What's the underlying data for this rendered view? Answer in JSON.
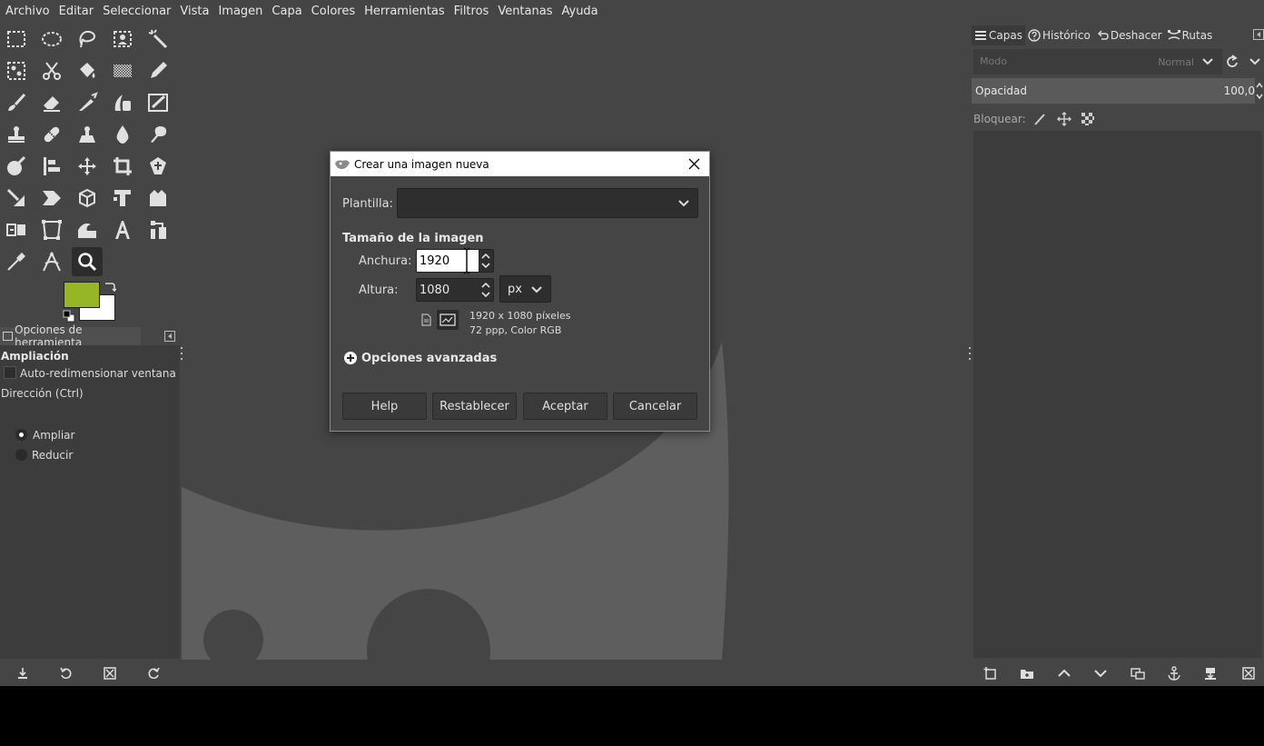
{
  "menubar": {
    "items": [
      "Archivo",
      "Editar",
      "Seleccionar",
      "Vista",
      "Imagen",
      "Capa",
      "Colores",
      "Herramientas",
      "Filtros",
      "Ventanas",
      "Ayuda"
    ]
  },
  "colors": {
    "foreground": "#97b625",
    "background": "#ffffff"
  },
  "tool_options": {
    "tab_label": "Opciones de herramienta",
    "heading": "Ampliación",
    "auto_resize_label": "Auto-redimensionar ventana",
    "direction_label": "Dirección  (Ctrl)",
    "zoom_in_label": "Ampliar",
    "zoom_out_label": "Reducir"
  },
  "right_dock": {
    "tabs": [
      "Capas",
      "Histórico",
      "Deshacer",
      "Rutas"
    ],
    "mode_label": "Modo",
    "mode_value": "Normal",
    "opacity_label": "Opacidad",
    "opacity_value": "100,0",
    "lock_label": "Bloquear:"
  },
  "dialog": {
    "title": "Crear una imagen nueva",
    "template_label": "Plantilla:",
    "template_value": "",
    "size_heading": "Tamaño de la imagen",
    "width_label": "Anchura:",
    "width_value": "1920",
    "height_label": "Altura:",
    "height_value": "1080",
    "unit": "px",
    "info_size": "1920 x 1080 píxeles",
    "info_res": "72 ppp, Color RGB",
    "advanced_label": "Opciones avanzadas",
    "buttons": {
      "help": "Help",
      "reset": "Restablecer",
      "ok": "Aceptar",
      "cancel": "Cancelar"
    }
  }
}
